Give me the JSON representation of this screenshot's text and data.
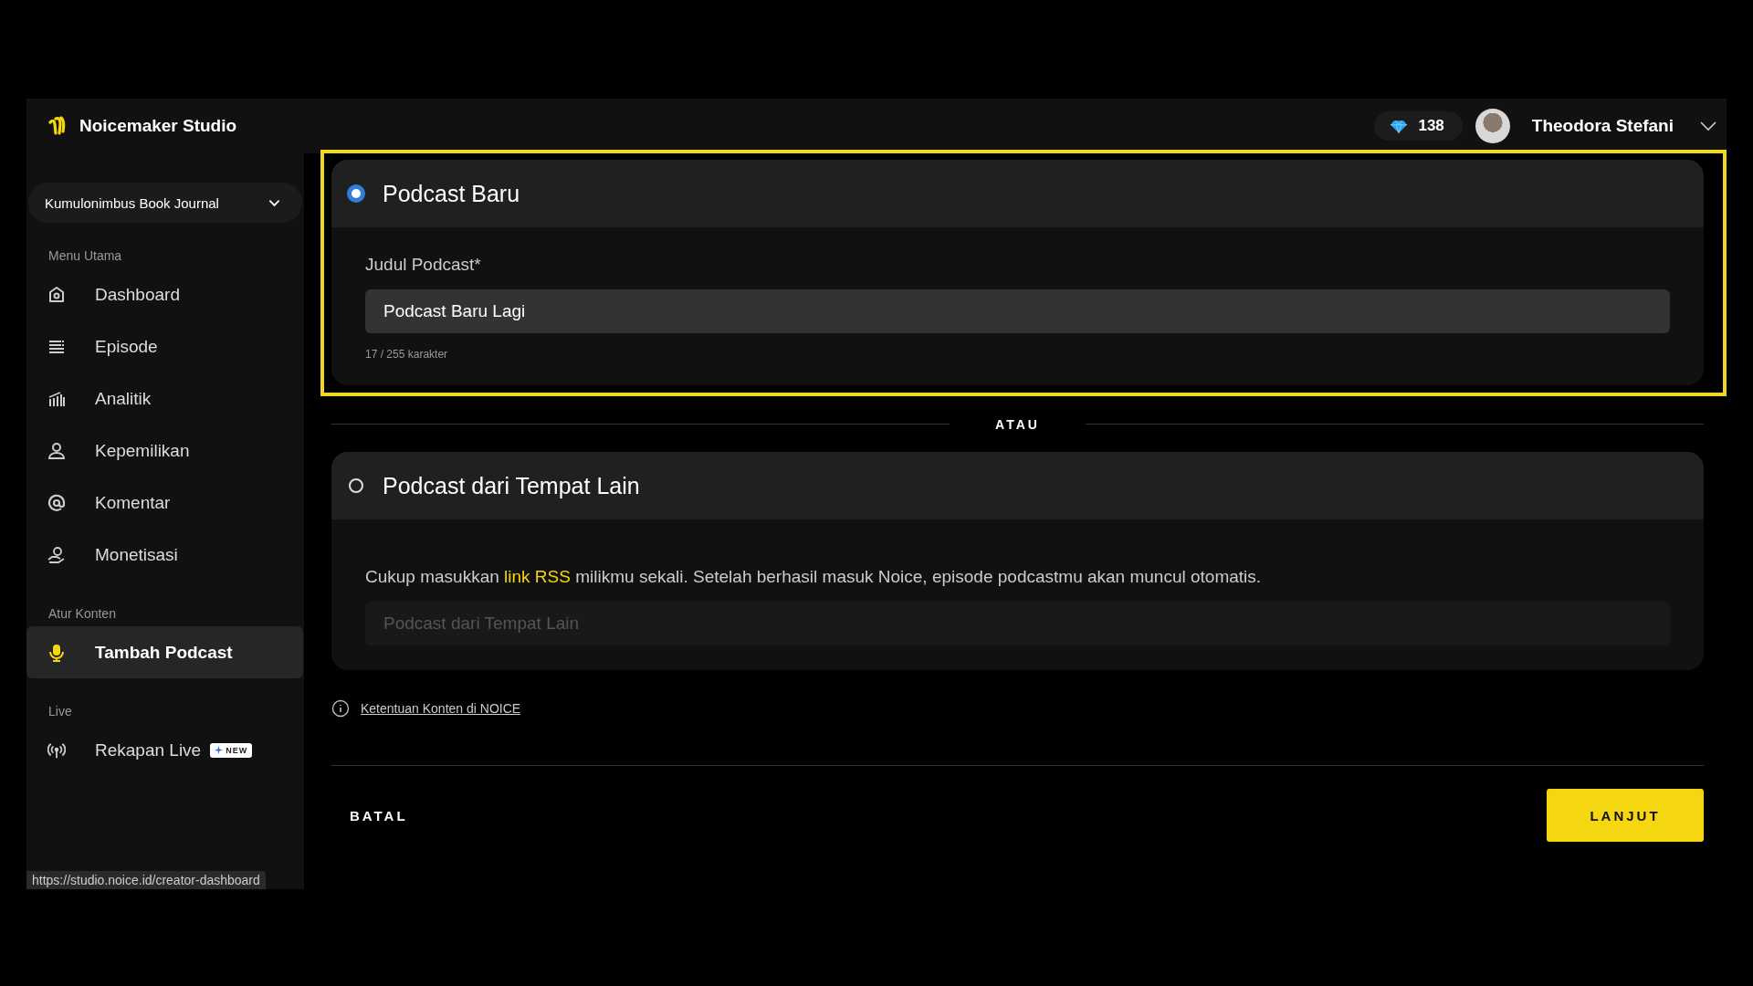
{
  "app": {
    "title": "Noicemaker Studio"
  },
  "header": {
    "gems": "138",
    "user_name": "Theodora Stefani"
  },
  "sidebar": {
    "podcast_selector": "Kumulonimbus Book Journal",
    "sections": [
      {
        "label": "Menu Utama",
        "items": [
          {
            "label": "Dashboard",
            "selected": false
          },
          {
            "label": "Episode",
            "selected": false
          },
          {
            "label": "Analitik",
            "selected": false
          },
          {
            "label": "Kepemilikan",
            "selected": false
          },
          {
            "label": "Komentar",
            "selected": false
          },
          {
            "label": "Monetisasi",
            "selected": false
          }
        ]
      },
      {
        "label": "Atur Konten",
        "items": [
          {
            "label": "Tambah Podcast",
            "selected": true
          }
        ]
      },
      {
        "label": "Live",
        "items": [
          {
            "label": "Rekapan Live",
            "selected": false,
            "badge": "NEW"
          }
        ]
      }
    ]
  },
  "options": [
    {
      "kind": "title_field",
      "title": "Podcast Baru",
      "selected": true,
      "highlighted": true,
      "field_label": "Judul Podcast*",
      "value": "Podcast Baru Lagi",
      "counter": "17 / 255 karakter"
    },
    {
      "kind": "rss_field",
      "title": "Podcast dari Tempat Lain",
      "selected": false,
      "highlighted": false,
      "description": "Cukup masukkan **link RSS** milikmu sekali. Setelah berhasil masuk Noice, episode podcastmu akan muncul otomatis.",
      "placeholder": "Podcast dari Tempat Lain"
    }
  ],
  "separator": "ATAU",
  "info_link": "Ketentuan Konten di NOICE",
  "buttons": {
    "cancel": "BATAL",
    "next": "LANJUT"
  },
  "status_url": "https://studio.noice.id/creator-dashboard"
}
